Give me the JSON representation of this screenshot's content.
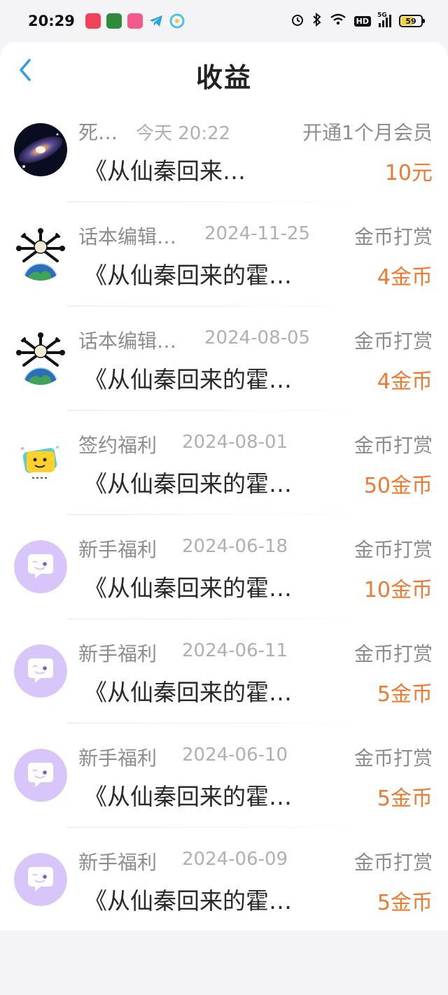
{
  "status_bar": {
    "time": "20:29",
    "notification_icons": [
      "music-app-icon",
      "reader-app-icon",
      "shopping-app-icon",
      "telegram-icon",
      "browser-icon"
    ],
    "right_icons": [
      "alarm-icon",
      "bluetooth-icon",
      "wifi-icon",
      "hd-icon",
      "signal-icon",
      "battery-icon"
    ],
    "hd": "HD",
    "network": "5G",
    "battery": "59"
  },
  "header": {
    "back_icon": "chevron-left-icon",
    "title": "收益"
  },
  "colors": {
    "accent_blue": "#2e9bf0",
    "amount_orange": "#ee7a31",
    "avatar_purple": "#d8c6fb"
  },
  "earnings": [
    {
      "avatar": "galaxy-avatar",
      "name": "死…",
      "date": "今天 20:22",
      "type": "开通1个月会员",
      "book": "《从仙秦回来…",
      "amount": "10元"
    },
    {
      "avatar": "mascot-globe-avatar",
      "name": "话本编辑…",
      "date": "2024-11-25",
      "type": "金币打赏",
      "book": "《从仙秦回来的霍…",
      "amount": "4金币"
    },
    {
      "avatar": "mascot-globe-avatar",
      "name": "话本编辑…",
      "date": "2024-08-05",
      "type": "金币打赏",
      "book": "《从仙秦回来的霍…",
      "amount": "4金币"
    },
    {
      "avatar": "sign-bonus-avatar",
      "name": "签约福利",
      "date": "2024-08-01",
      "type": "金币打赏",
      "book": "《从仙秦回来的霍…",
      "amount": "50金币"
    },
    {
      "avatar": "chat-bubble-avatar",
      "name": "新手福利",
      "date": "2024-06-18",
      "type": "金币打赏",
      "book": "《从仙秦回来的霍…",
      "amount": "10金币"
    },
    {
      "avatar": "chat-bubble-avatar",
      "name": "新手福利",
      "date": "2024-06-11",
      "type": "金币打赏",
      "book": "《从仙秦回来的霍…",
      "amount": "5金币"
    },
    {
      "avatar": "chat-bubble-avatar",
      "name": "新手福利",
      "date": "2024-06-10",
      "type": "金币打赏",
      "book": "《从仙秦回来的霍…",
      "amount": "5金币"
    },
    {
      "avatar": "chat-bubble-avatar",
      "name": "新手福利",
      "date": "2024-06-09",
      "type": "金币打赏",
      "book": "《从仙秦回来的霍…",
      "amount": "5金币"
    }
  ]
}
